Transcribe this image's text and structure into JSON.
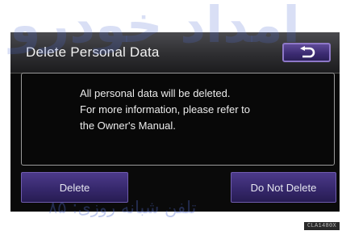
{
  "header": {
    "title": "Delete Personal Data",
    "back_icon": "return-arrow-icon"
  },
  "message": {
    "lines": [
      "All personal data will be deleted.",
      "For more information, please refer to",
      "the Owner's Manual."
    ]
  },
  "actions": {
    "delete_label": "Delete",
    "do_not_delete_label": "Do Not Delete"
  },
  "image_code": "CLA1480X",
  "watermark": {
    "logo_text": "امداد خودرو",
    "phone_text": "تلفن شبانه روزی: ۸۵"
  },
  "colors": {
    "screen_background": "#0a0a0a",
    "button_purple": "#3a2a70",
    "button_border": "#6f5cae",
    "text": "#ececec"
  }
}
